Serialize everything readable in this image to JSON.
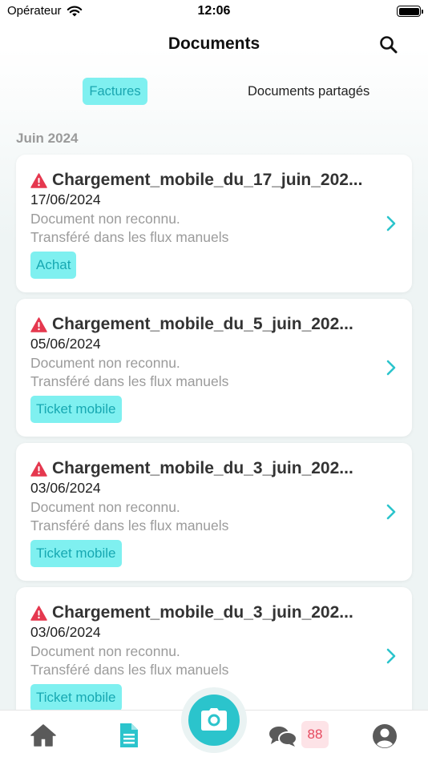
{
  "status_bar": {
    "carrier": "Opérateur",
    "time": "12:06"
  },
  "header": {
    "title": "Documents"
  },
  "tabs": [
    {
      "label": "Factures",
      "active": true
    },
    {
      "label": "Documents partagés",
      "active": false
    }
  ],
  "section": {
    "title": "Juin 2024"
  },
  "documents": [
    {
      "name": "Chargement_mobile_du_17_juin_202...",
      "date": "17/06/2024",
      "message_line1": "Document non reconnu.",
      "message_line2": "Transféré dans les flux manuels",
      "tag": "Achat"
    },
    {
      "name": "Chargement_mobile_du_5_juin_202...",
      "date": "05/06/2024",
      "message_line1": "Document non reconnu.",
      "message_line2": "Transféré dans les flux manuels",
      "tag": "Ticket mobile"
    },
    {
      "name": "Chargement_mobile_du_3_juin_202...",
      "date": "03/06/2024",
      "message_line1": "Document non reconnu.",
      "message_line2": "Transféré dans les flux manuels",
      "tag": "Ticket mobile"
    },
    {
      "name": "Chargement_mobile_du_3_juin_202...",
      "date": "03/06/2024",
      "message_line1": "Document non reconnu.",
      "message_line2": "Transféré dans les flux manuels",
      "tag": "Ticket mobile"
    }
  ],
  "tabbar": {
    "items": [
      "home-icon",
      "document-icon",
      "camera-icon",
      "chat-icon",
      "profile-icon"
    ],
    "messages_badge": "88"
  },
  "colors": {
    "accent": "#2bc4cc",
    "tag_bg": "#7ff0f0",
    "warning": "#e5384f",
    "badge_bg": "#fde3e7",
    "badge_text": "#e64a5f"
  }
}
